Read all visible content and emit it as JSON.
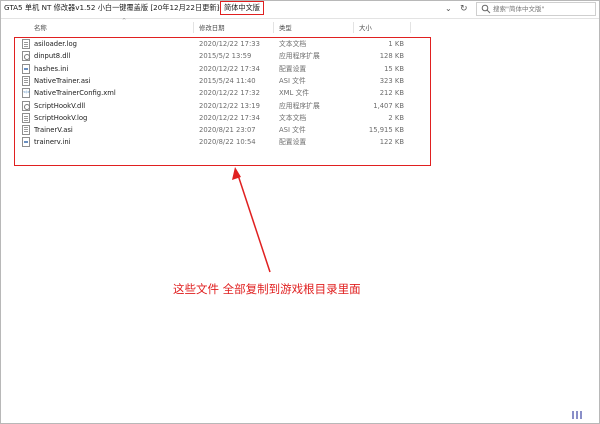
{
  "address_bar": {
    "parent_folder": "GTA5 单机 NT 修改器v1.52 小白一键覆盖版 [20年12月22日更新]",
    "separator": "›",
    "current_folder": "简体中文版",
    "search_placeholder": "搜索\"简体中文版\""
  },
  "columns": {
    "name": "名称",
    "date": "修改日期",
    "type": "类型",
    "size": "大小"
  },
  "files": [
    {
      "name": "asiloader.log",
      "date": "2020/12/22 17:33",
      "type": "文本文档",
      "size": "1 KB",
      "icon": "log"
    },
    {
      "name": "dinput8.dll",
      "date": "2015/5/2 13:59",
      "type": "应用程序扩展",
      "size": "128 KB",
      "icon": "dll"
    },
    {
      "name": "hashes.ini",
      "date": "2020/12/22 17:34",
      "type": "配置设置",
      "size": "15 KB",
      "icon": "ini"
    },
    {
      "name": "NativeTrainer.asi",
      "date": "2015/5/24 11:40",
      "type": "ASI 文件",
      "size": "323 KB",
      "icon": "asi"
    },
    {
      "name": "NativeTrainerConfig.xml",
      "date": "2020/12/22 17:32",
      "type": "XML 文件",
      "size": "212 KB",
      "icon": "xml"
    },
    {
      "name": "ScriptHookV.dll",
      "date": "2020/12/22 13:19",
      "type": "应用程序扩展",
      "size": "1,407 KB",
      "icon": "dll"
    },
    {
      "name": "ScriptHookV.log",
      "date": "2020/12/22 17:34",
      "type": "文本文档",
      "size": "2 KB",
      "icon": "log"
    },
    {
      "name": "TrainerV.asi",
      "date": "2020/8/21 23:07",
      "type": "ASI 文件",
      "size": "15,915 KB",
      "icon": "asi"
    },
    {
      "name": "trainerv.ini",
      "date": "2020/8/22 10:54",
      "type": "配置设置",
      "size": "122 KB",
      "icon": "ini"
    }
  ],
  "annotation": {
    "text": "这些文件 全部复制到游戏根目录里面",
    "color": "#e02020"
  }
}
